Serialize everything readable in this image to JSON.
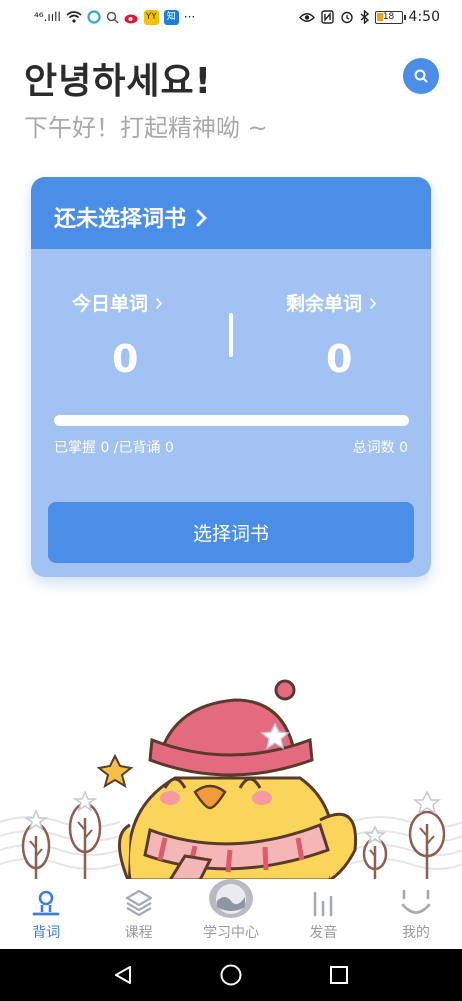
{
  "status": {
    "signal": "⁴⁶.ııll",
    "time": "4:50",
    "battery": "18",
    "app_badges": [
      "YY",
      "知"
    ]
  },
  "header": {
    "greeting": "안녕하세요!",
    "subgreeting": "下午好！打起精神呦 ~"
  },
  "card": {
    "title": "还未选择词书",
    "today_label": "今日单词",
    "today_value": "0",
    "remaining_label": "剩余单词",
    "remaining_value": "0",
    "mastered_text": "已掌握 0 /已背诵 0",
    "total_text": "总词数 0",
    "progress": 0,
    "choose_button": "选择词书"
  },
  "tabs": [
    {
      "label": "背词",
      "icon": "memorize-icon",
      "active": true
    },
    {
      "label": "课程",
      "icon": "layers-icon",
      "active": false
    },
    {
      "label": "学习中心",
      "icon": "study-center-icon",
      "active": false
    },
    {
      "label": "发音",
      "icon": "pronunciation-icon",
      "active": false
    },
    {
      "label": "我的",
      "icon": "smile-icon",
      "active": false
    }
  ],
  "colors": {
    "accent": "#4a8ee8",
    "card_body": "#a1c2f3",
    "active_tab": "#3a7fe0",
    "inactive_tab": "#9a9a9a"
  }
}
